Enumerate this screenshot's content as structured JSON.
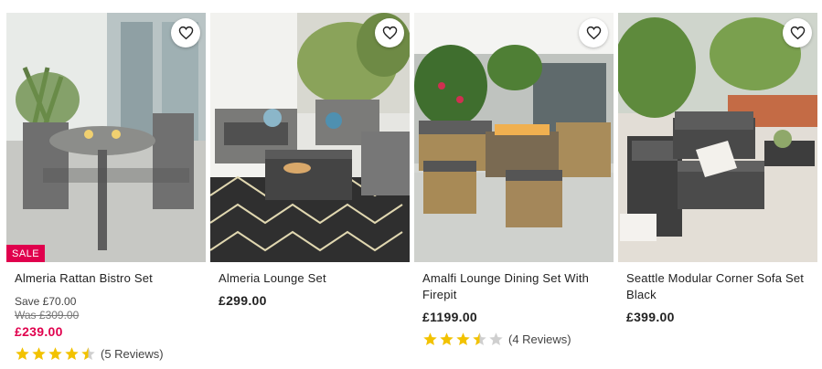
{
  "products": [
    {
      "title": "Almeria Rattan Bistro Set",
      "badge": "SALE",
      "save": "Save £70.00",
      "was": "Was £309.00",
      "price": "£239.00",
      "rating": 4.5,
      "reviews": "(5 Reviews)"
    },
    {
      "title": "Almeria Lounge Set",
      "price": "£299.00"
    },
    {
      "title": "Amalfi Lounge Dining Set With Firepit",
      "price": "£1199.00",
      "rating": 3.5,
      "reviews": "(4 Reviews)"
    },
    {
      "title": "Seattle Modular Corner Sofa Set Black",
      "price": "£399.00"
    }
  ],
  "colors": {
    "sale": "#e0004d",
    "star": "#f2c200",
    "star_empty": "#cfcfcf"
  },
  "icons": {
    "wishlist": "heart-outline-icon",
    "rating": "star-icon"
  }
}
